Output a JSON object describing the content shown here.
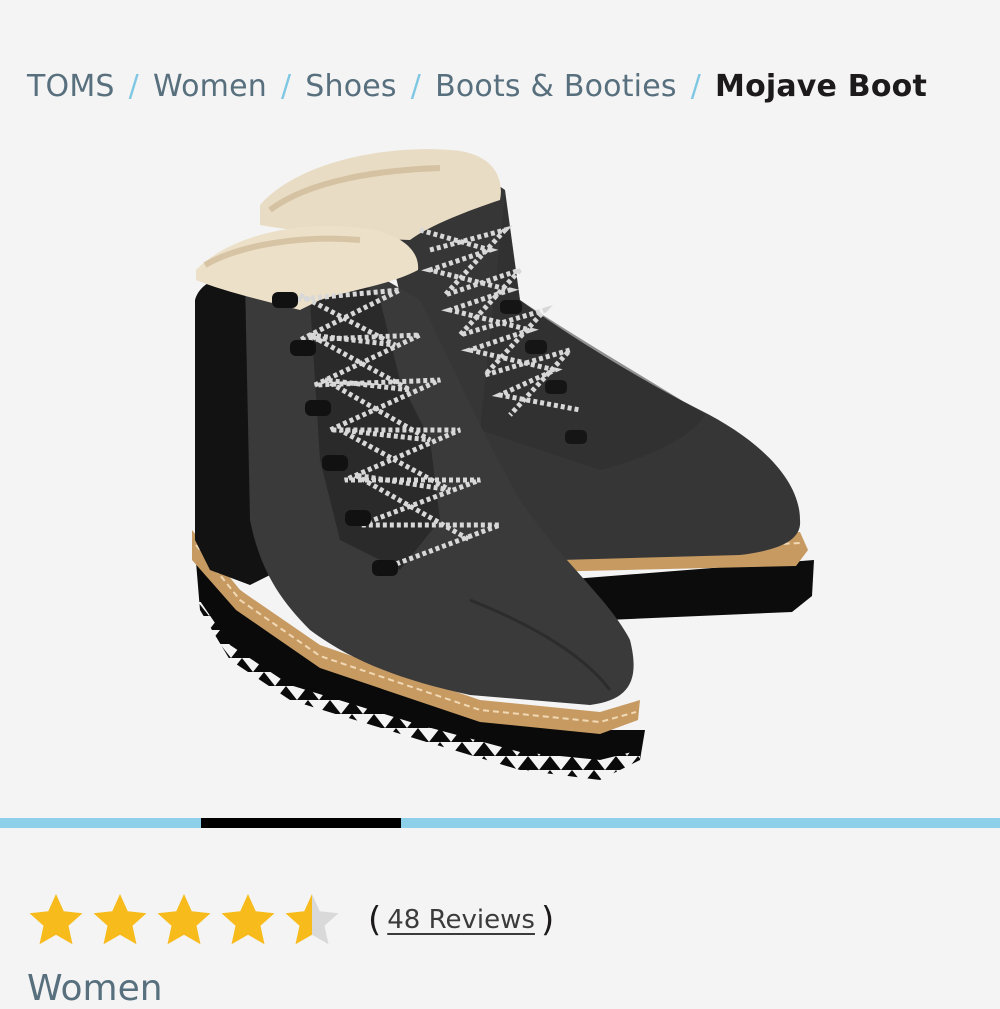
{
  "breadcrumb": {
    "items": [
      {
        "label": "TOMS"
      },
      {
        "label": "Women"
      },
      {
        "label": "Shoes"
      },
      {
        "label": "Boots & Booties"
      }
    ],
    "current": "Mojave Boot",
    "separator": "/"
  },
  "gallery": {
    "image_alt": "Mojave Boot — black boots with faux-fur collar, speckled laces and serrated sole",
    "active_slide": 2,
    "slide_count": 5
  },
  "rating": {
    "value": 4.5,
    "max": 5,
    "star_color": "#f7bb1c",
    "empty_color": "#d9d9d9",
    "open_paren": "(",
    "reviews_label": "48 Reviews",
    "close_paren": ")"
  },
  "product": {
    "category": "Women"
  }
}
